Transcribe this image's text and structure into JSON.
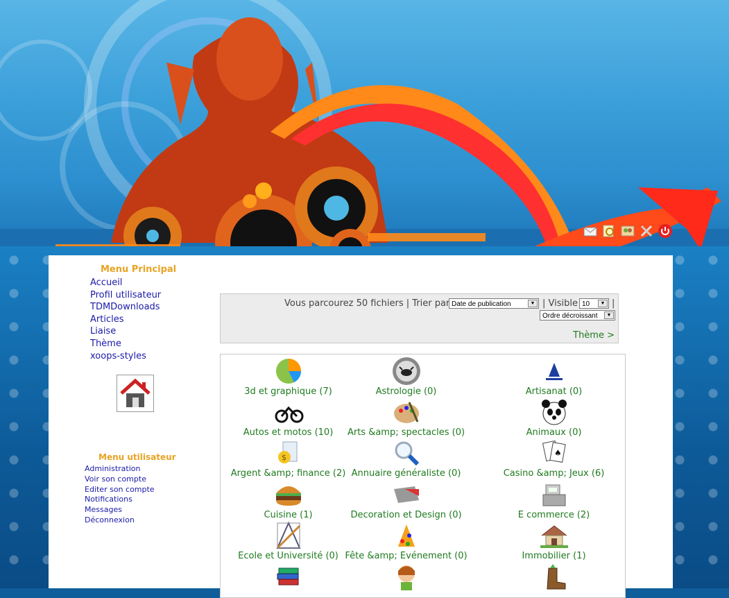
{
  "menu_principal": {
    "title": "Menu Principal",
    "items": [
      "Accueil",
      "Profil utilisateur",
      "TDMDownloads",
      "Articles",
      "Liaise",
      "Thème",
      "xoops-styles"
    ]
  },
  "menu_utilisateur": {
    "title": "Menu utilisateur",
    "items": [
      "Administration",
      "Voir son compte",
      "Editer son compte",
      "Notifications",
      "Messages",
      "Déconnexion"
    ]
  },
  "sortbar": {
    "browse_text": "Vous parcourez 50 fichiers | Trier par",
    "sort_value": "Date de publication",
    "visible_label": "| Visible",
    "visible_value": "10",
    "sep": "|",
    "order_value": "Ordre décroissant",
    "theme_link": "Thème >"
  },
  "categories": [
    {
      "label": "3d et graphique (7)",
      "icon": "pie-chart"
    },
    {
      "label": "Astrologie (0)",
      "icon": "crab-sign"
    },
    {
      "label": "Artisanat (0)",
      "icon": "artisan-logo"
    },
    {
      "label": "Autos et motos (10)",
      "icon": "motorbike"
    },
    {
      "label": "Arts &amp; spectacles (0)",
      "icon": "palette"
    },
    {
      "label": "Animaux (0)",
      "icon": "panda"
    },
    {
      "label": "Argent &amp; finance (2)",
      "icon": "money"
    },
    {
      "label": "Annuaire généraliste (0)",
      "icon": "magnifier"
    },
    {
      "label": "Casino &amp; Jeux (6)",
      "icon": "cards"
    },
    {
      "label": "Cuisine (1)",
      "icon": "burger"
    },
    {
      "label": "Decoration et Design (0)",
      "icon": "design"
    },
    {
      "label": "E commerce (2)",
      "icon": "cash-register"
    },
    {
      "label": "Ecole et Université (0)",
      "icon": "geometry"
    },
    {
      "label": "Fête &amp; Evénement (0)",
      "icon": "party"
    },
    {
      "label": "Immobilier (1)",
      "icon": "house"
    },
    {
      "label": "",
      "icon": "books"
    },
    {
      "label": "",
      "icon": "girl"
    },
    {
      "label": "",
      "icon": "boot"
    }
  ],
  "colors": {
    "link": "#1a1aa8",
    "block_title": "#e8a323",
    "category_text": "#1f7a1f"
  }
}
